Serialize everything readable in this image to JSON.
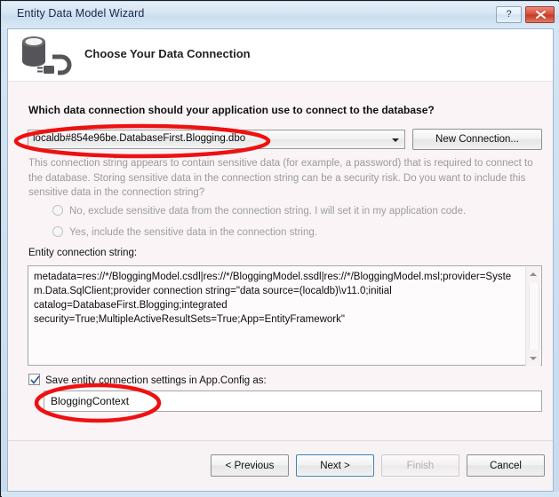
{
  "window": {
    "title": "Entity Data Model Wizard",
    "help_button_label": "?",
    "close_button_label": "x",
    "icon_name": "database-connection-icon"
  },
  "header": {
    "title": "Choose Your Data Connection"
  },
  "main": {
    "question": "Which data connection should your application use to connect to the database?",
    "connection_combo": {
      "value": "localdb#854e96be.DatabaseFirst.Blogging.dbo",
      "arrow_icon": "chevron-down-icon"
    },
    "new_connection_label": "New Connection...",
    "sensitive_warning": "This connection string appears to contain sensitive data (for example, a password) that is required to connect to the database. Storing sensitive data in the connection string can be a security risk. Do you want to include this sensitive data in the connection string?",
    "radio_options": [
      {
        "label": "No, exclude sensitive data from the connection string. I will set it in my application code.",
        "selected": false,
        "enabled": false
      },
      {
        "label": "Yes, include the sensitive data in the connection string.",
        "selected": false,
        "enabled": false
      }
    ],
    "entity_connection_label": "Entity connection string:",
    "entity_connection_value": "metadata=res://*/BloggingModel.csdl|res://*/BloggingModel.ssdl|res://*/BloggingModel.msl;provider=System.Data.SqlClient;provider connection string=\"data source=(localdb)\\v11.0;initial catalog=DatabaseFirst.Blogging;integrated security=True;MultipleActiveResultSets=True;App=EntityFramework\"",
    "save_checkbox": {
      "label": "Save entity connection settings in App.Config as:",
      "checked": true
    },
    "config_name_value": "BloggingContext"
  },
  "footer": {
    "previous_label": "< Previous",
    "next_label": "Next >",
    "finish_label": "Finish",
    "cancel_label": "Cancel"
  },
  "annotations": {
    "ellipse_color": "#ee1111",
    "items": [
      {
        "name": "connection-combo-highlight"
      },
      {
        "name": "config-name-highlight"
      }
    ]
  },
  "colors": {
    "titlebar": "#d5e4f2",
    "body_bg": "#faf4f6",
    "accent_blue": "#3c7fb1",
    "close_red": "#d9503b",
    "disabled_text": "#9a9a9a"
  }
}
